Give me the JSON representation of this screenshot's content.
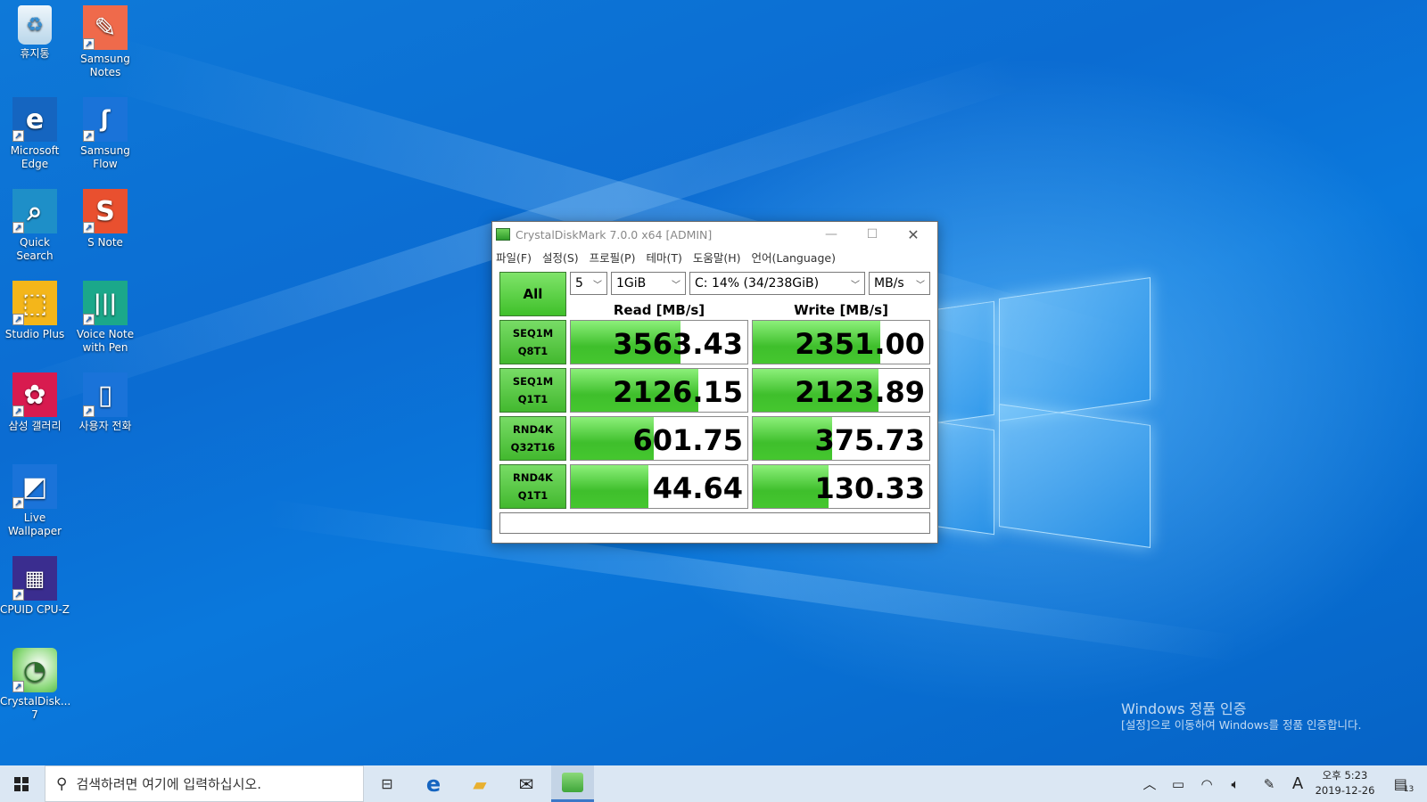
{
  "desktop_icons": [
    {
      "label": "휴지통",
      "icon": "recycle-bin-icon"
    },
    {
      "label": "Samsung Notes",
      "icon": "samsung-notes-icon"
    },
    {
      "label": "Microsoft Edge",
      "icon": "edge-icon"
    },
    {
      "label": "Samsung Flow",
      "icon": "samsung-flow-icon"
    },
    {
      "label": "Quick Search",
      "icon": "quick-search-icon"
    },
    {
      "label": "S Note",
      "icon": "s-note-icon"
    },
    {
      "label": "Studio Plus",
      "icon": "studio-plus-icon"
    },
    {
      "label": "Voice Note with Pen",
      "icon": "voice-note-icon"
    },
    {
      "label": "삼성 갤러리",
      "icon": "gallery-icon"
    },
    {
      "label": "사용자 전화",
      "icon": "phone-icon"
    },
    {
      "label": "Live Wallpaper",
      "icon": "live-wallpaper-icon"
    },
    {
      "label": "CPUID CPU-Z",
      "icon": "cpuz-icon"
    },
    {
      "label": "CrystalDisk... 7",
      "icon": "crystaldisk-icon"
    }
  ],
  "window": {
    "title": "CrystalDiskMark 7.0.0 x64 [ADMIN]",
    "menu": [
      "파일(F)",
      "설정(S)",
      "프로필(P)",
      "테마(T)",
      "도움말(H)",
      "언어(Language)"
    ],
    "all_label": "All",
    "count_value": "5",
    "size_value": "1GiB",
    "drive_value": "C: 14% (34/238GiB)",
    "unit_value": "MB/s",
    "read_header": "Read [MB/s]",
    "write_header": "Write [MB/s]",
    "status_text": "",
    "accent_color": "#45c72f",
    "rows": [
      {
        "line1": "SEQ1M",
        "line2": "Q8T1",
        "read": "3563.43",
        "read_fill": 0.62,
        "write": "2351.00",
        "write_fill": 0.72
      },
      {
        "line1": "SEQ1M",
        "line2": "Q1T1",
        "read": "2126.15",
        "read_fill": 0.72,
        "write": "2123.89",
        "write_fill": 0.71
      },
      {
        "line1": "RND4K",
        "line2": "Q32T16",
        "read": "601.75",
        "read_fill": 0.47,
        "write": "375.73",
        "write_fill": 0.45
      },
      {
        "line1": "RND4K",
        "line2": "Q1T1",
        "read": "44.64",
        "read_fill": 0.44,
        "write": "130.33",
        "write_fill": 0.43
      }
    ]
  },
  "watermark": {
    "line1": "Windows 정품 인증",
    "line2": "[설정]으로 이동하여 Windows를 정품 인증합니다."
  },
  "taskbar": {
    "search_placeholder": "검색하려면 여기에 입력하십시오.",
    "time": "오후 5:23",
    "date": "2019-12-26",
    "ime": "A",
    "notification_count": "13"
  }
}
